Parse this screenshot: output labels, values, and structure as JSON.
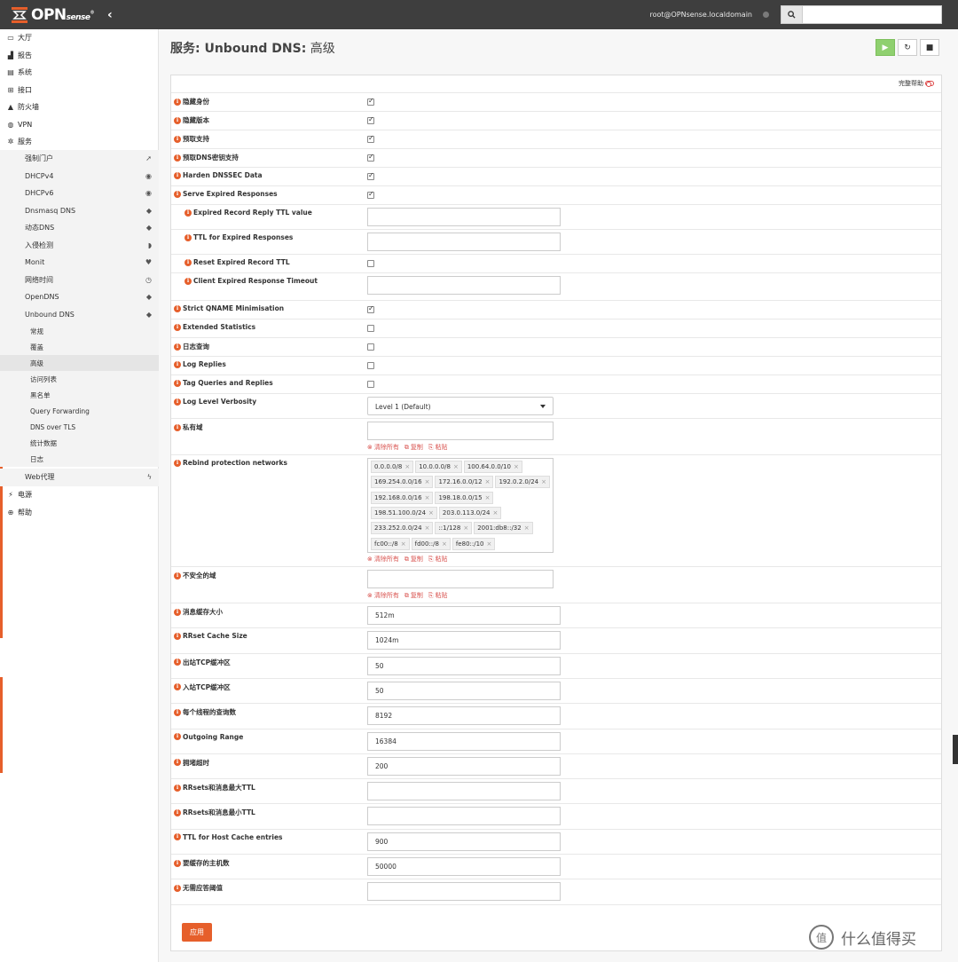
{
  "header": {
    "logo_main": "OPN",
    "logo_small": "sense",
    "logo_reg": "®",
    "user": "root@OPNsense.localdomain",
    "search_placeholder": ""
  },
  "sidebar": {
    "top_items": [
      {
        "label": "大厅",
        "icon": "laptop-icon",
        "glyph": "▭"
      },
      {
        "label": "报告",
        "icon": "chart-icon",
        "glyph": "▟"
      },
      {
        "label": "系统",
        "icon": "server-icon",
        "glyph": "▤"
      },
      {
        "label": "接口",
        "icon": "sitemap-icon",
        "glyph": "⊞"
      },
      {
        "label": "防火墙",
        "icon": "fire-icon",
        "glyph": "▲"
      },
      {
        "label": "VPN",
        "icon": "globe-icon",
        "glyph": "◍"
      },
      {
        "label": "服务",
        "icon": "cog-icon",
        "glyph": "✲"
      }
    ],
    "services": [
      {
        "label": "强制门户",
        "icon": "send-icon",
        "glyph": "➚"
      },
      {
        "label": "DHCPv4",
        "icon": "bullseye-icon",
        "glyph": "◉"
      },
      {
        "label": "DHCPv6",
        "icon": "bullseye-icon",
        "glyph": "◉"
      },
      {
        "label": "Dnsmasq DNS",
        "icon": "tags-icon",
        "glyph": "◆"
      },
      {
        "label": "动态DNS",
        "icon": "tags-icon",
        "glyph": "◆"
      },
      {
        "label": "入侵检测",
        "icon": "shield-icon",
        "glyph": "◗"
      },
      {
        "label": "Monit",
        "icon": "heartbeat-icon",
        "glyph": "♥"
      },
      {
        "label": "网络时间",
        "icon": "clock-icon",
        "glyph": "◷"
      },
      {
        "label": "OpenDNS",
        "icon": "tags-icon",
        "glyph": "◆"
      },
      {
        "label": "Unbound DNS",
        "icon": "tags-icon",
        "glyph": "◆"
      }
    ],
    "unbound_sub": [
      "常规",
      "覆盖",
      "高级",
      "访问列表",
      "黑名单",
      "Query Forwarding",
      "DNS over TLS",
      "统计数据",
      "日志"
    ],
    "web_proxy": {
      "label": "Web代理",
      "icon": "bolt-icon",
      "glyph": "ϟ"
    },
    "bottom_items": [
      {
        "label": "电源",
        "icon": "plug-icon",
        "glyph": "⚡"
      },
      {
        "label": "帮助",
        "icon": "lifebuoy-icon",
        "glyph": "⊕"
      }
    ]
  },
  "page": {
    "title_bold": "服务: Unbound DNS:",
    "title_rest": " 高级",
    "full_help": "完整帮助",
    "apply": "应用"
  },
  "form": {
    "checkboxes": [
      {
        "label": "隐藏身份",
        "checked": true
      },
      {
        "label": "隐藏版本",
        "checked": true
      },
      {
        "label": "预取支持",
        "checked": true
      },
      {
        "label": "预取DNS密钥支持",
        "checked": true
      },
      {
        "label": "Harden DNSSEC Data",
        "checked": true
      },
      {
        "label": "Serve Expired Responses",
        "checked": true
      }
    ],
    "expired": [
      {
        "label": "Expired Record Reply TTL value",
        "value": ""
      },
      {
        "label": "TTL for Expired Responses",
        "value": ""
      },
      {
        "label": "Reset Expired Record TTL",
        "checked": false
      },
      {
        "label": "Client Expired Response Timeout",
        "value": ""
      }
    ],
    "checkboxes2": [
      {
        "label": "Strict QNAME Minimisation",
        "checked": true
      },
      {
        "label": "Extended Statistics",
        "checked": false
      },
      {
        "label": "日志查询",
        "checked": false
      },
      {
        "label": "Log Replies",
        "checked": false
      },
      {
        "label": "Tag Queries and Replies",
        "checked": false
      }
    ],
    "log_level": {
      "label": "Log Level Verbosity",
      "value": "Level 1 (Default)"
    },
    "private_domain": {
      "label": "私有域"
    },
    "rebind": {
      "label": "Rebind protection networks",
      "tags": [
        "0.0.0.0/8",
        "10.0.0.0/8",
        "100.64.0.0/10",
        "169.254.0.0/16",
        "172.16.0.0/12",
        "192.0.2.0/24",
        "192.168.0.0/16",
        "198.18.0.0/15",
        "198.51.100.0/24",
        "203.0.113.0/24",
        "233.252.0.0/24",
        "::1/128",
        "2001:db8::/32",
        "fc00::/8",
        "fd00::/8",
        "fe80::/10"
      ]
    },
    "insecure_domain": {
      "label": "不安全的域"
    },
    "tag_actions": {
      "clear": "清除所有",
      "copy": "复制",
      "paste": "粘贴"
    },
    "text_fields": [
      {
        "label": "消息缓存大小",
        "value": "512m"
      },
      {
        "label": "RRset Cache Size",
        "value": "1024m"
      },
      {
        "label": "出站TCP缓冲区",
        "value": "50"
      },
      {
        "label": "入站TCP缓冲区",
        "value": "50"
      },
      {
        "label": "每个线程的查询数",
        "value": "8192"
      },
      {
        "label": "Outgoing Range",
        "value": "16384"
      },
      {
        "label": "拥堵超时",
        "value": "200"
      },
      {
        "label": "RRsets和消息最大TTL",
        "value": ""
      },
      {
        "label": "RRsets和消息最小TTL",
        "value": ""
      },
      {
        "label": "TTL for Host Cache entries",
        "value": "900"
      },
      {
        "label": "要缓存的主机数",
        "value": "50000"
      },
      {
        "label": "无需应答阈值",
        "value": ""
      }
    ]
  },
  "watermark": {
    "text": "什么值得买",
    "glyph": "值"
  },
  "colors": {
    "accent": "#e65f2b",
    "navbar": "#3e3e3e",
    "play": "#8fd06f"
  }
}
